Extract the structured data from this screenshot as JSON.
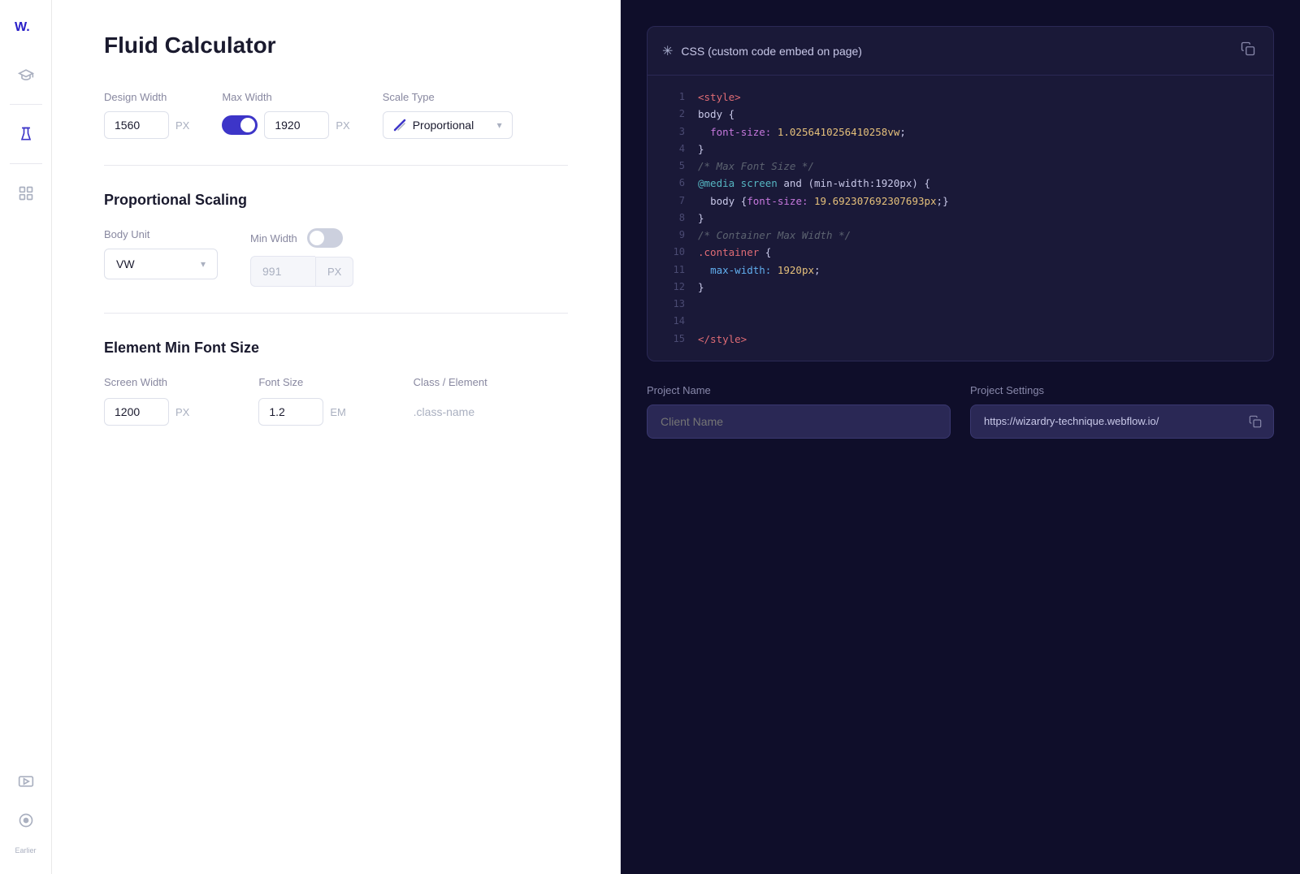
{
  "app": {
    "title": "Fluid Calculator",
    "logo": "W."
  },
  "sidebar": {
    "items": [
      {
        "id": "learn",
        "icon": "graduation-cap",
        "active": false
      },
      {
        "id": "lab",
        "icon": "flask",
        "active": true
      },
      {
        "id": "layers",
        "icon": "layers",
        "active": false
      }
    ],
    "bottom": [
      {
        "id": "video",
        "icon": "play-circle"
      },
      {
        "id": "circle",
        "icon": "circle"
      }
    ],
    "earlier_label": "Earlier"
  },
  "calculator": {
    "title": "Fluid Calculator",
    "design_width_label": "Design Width",
    "design_width_value": "1560",
    "design_width_unit": "PX",
    "max_width_label": "Max Width",
    "max_width_value": "1920",
    "max_width_unit": "PX",
    "max_width_toggle": true,
    "scale_type_label": "Scale Type",
    "scale_type_value": "Proportional"
  },
  "proportional_scaling": {
    "section_title": "Proportional Scaling",
    "body_unit_label": "Body Unit",
    "body_unit_value": "VW",
    "min_width_label": "Min Width",
    "min_width_toggle": false,
    "min_width_value": "991",
    "min_width_unit": "PX"
  },
  "element_min_font_size": {
    "section_title": "Element Min Font Size",
    "screen_width_col": "Screen Width",
    "font_size_col": "Font Size",
    "class_element_col": "Class / Element",
    "screen_width_value": "1200",
    "screen_width_unit": "PX",
    "font_size_value": "1.2",
    "font_size_unit": "EM",
    "class_value": ".class-name"
  },
  "code_block": {
    "title": "CSS (custom code embed on page)",
    "lines": [
      {
        "num": 1,
        "type": "tag",
        "content": "<style>"
      },
      {
        "num": 2,
        "type": "selector",
        "content": "body {"
      },
      {
        "num": 3,
        "type": "property-value",
        "prop": "  font-size: ",
        "val": "1.0256410256410258vw",
        "suffix": ";"
      },
      {
        "num": 4,
        "type": "bracket",
        "content": "}"
      },
      {
        "num": 5,
        "type": "comment",
        "content": "/* Max Font Size */"
      },
      {
        "num": 6,
        "type": "media",
        "content": "@media screen and (min-width:1920px) {"
      },
      {
        "num": 7,
        "type": "nested",
        "selector": "  body ",
        "brace": "{",
        "prop": "font-size: ",
        "val": "19.692307692307693px",
        "suffix": ";}"
      },
      {
        "num": 8,
        "type": "bracket",
        "content": "}"
      },
      {
        "num": 9,
        "type": "comment",
        "content": "/* Container Max Width */"
      },
      {
        "num": 10,
        "type": "classname",
        "content": ".container {"
      },
      {
        "num": 11,
        "type": "maxwidth",
        "prop": "  max-width: ",
        "val": "1920px",
        "suffix": ";"
      },
      {
        "num": 12,
        "type": "bracket",
        "content": "}"
      },
      {
        "num": 13,
        "type": "empty",
        "content": ""
      },
      {
        "num": 14,
        "type": "empty",
        "content": ""
      },
      {
        "num": 15,
        "type": "tag",
        "content": "</style>"
      }
    ]
  },
  "project": {
    "name_label": "Project Name",
    "name_placeholder": "Client Name",
    "settings_label": "Project Settings",
    "url_value": "https://wizardry-technique.webflow.io/"
  }
}
